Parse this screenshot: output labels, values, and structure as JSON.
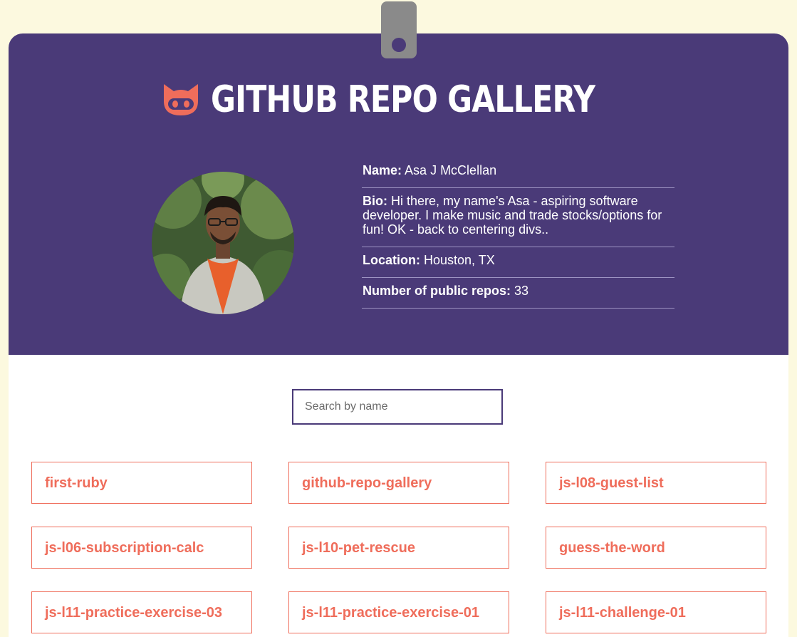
{
  "header": {
    "title": "GITHUB REPO GALLERY",
    "logo_icon": "github-octocat-icon",
    "accent_color": "#ef6d5b",
    "brand_color": "#4a3a78"
  },
  "profile": {
    "name_label": "Name:",
    "name": "Asa J McClellan",
    "bio_label": "Bio:",
    "bio": "Hi there, my name's Asa - aspiring software developer. I make music and trade stocks/options for fun! OK - back to centering divs..",
    "location_label": "Location:",
    "location": "Houston, TX",
    "repos_label": "Number of public repos:",
    "repos_count": "33"
  },
  "search": {
    "placeholder": "Search by name",
    "value": ""
  },
  "repos": [
    "first-ruby",
    "github-repo-gallery",
    "js-l08-guest-list",
    "js-l06-subscription-calc",
    "js-l10-pet-rescue",
    "guess-the-word",
    "js-l11-practice-exercise-03",
    "js-l11-practice-exercise-01",
    "js-l11-challenge-01"
  ]
}
